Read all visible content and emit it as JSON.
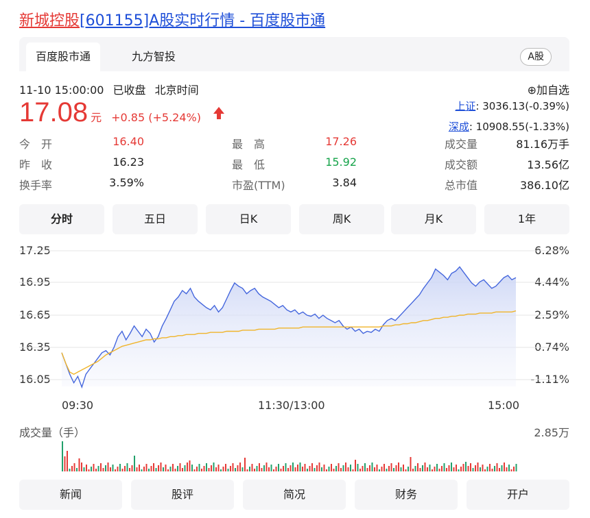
{
  "title": {
    "stock": "新城控股",
    "rest": "[601155]A股实时行情 - 百度股市通"
  },
  "tabs": [
    "百度股市通",
    "九方智投"
  ],
  "market_badge": "A股",
  "status": {
    "datetime": "11-10 15:00:00",
    "state": "已收盘",
    "tz": "北京时间"
  },
  "watchlist": "⊕加自选",
  "quote": {
    "price": "17.08",
    "unit": "元",
    "change": "+0.85 (+5.24%)",
    "up_color": "#e53935",
    "down_color": "#16a34a"
  },
  "indices": [
    {
      "name": "上证",
      "value": ": 3036.13(-0.39%)"
    },
    {
      "name": "深成",
      "value": ": 10908.55(-1.33%)"
    }
  ],
  "stats": [
    [
      {
        "label": "今　开",
        "value": "16.40",
        "color": "red"
      },
      {
        "label": "最　高",
        "value": "17.26",
        "color": "red"
      },
      {
        "label": "成交量",
        "value": "81.16万手",
        "color": "black"
      }
    ],
    [
      {
        "label": "昨　收",
        "value": "16.23",
        "color": "black"
      },
      {
        "label": "最　低",
        "value": "15.92",
        "color": "green"
      },
      {
        "label": "成交额",
        "value": "13.56亿",
        "color": "black"
      }
    ],
    [
      {
        "label": "换手率",
        "value": "3.59%",
        "color": "black"
      },
      {
        "label": "市盈(TTM)",
        "value": "3.84",
        "color": "black"
      },
      {
        "label": "总市值",
        "value": "386.10亿",
        "color": "black"
      }
    ]
  ],
  "periods": [
    "分时",
    "五日",
    "日K",
    "周K",
    "月K",
    "1年"
  ],
  "chart_data": {
    "type": "line",
    "price_ticks": [
      "17.25",
      "16.95",
      "16.65",
      "16.35",
      "16.05"
    ],
    "pct_ticks": [
      "6.28%",
      "4.44%",
      "2.59%",
      "0.74%",
      "-1.11%"
    ],
    "x_ticks": [
      "09:30",
      "11:30/13:00",
      "15:00"
    ],
    "ylim": [
      16.05,
      17.25
    ],
    "price_color": "#4466dd",
    "avg_color": "#f0b429",
    "series": [
      {
        "values": [
          16.3,
          16.2,
          16.1,
          16.02,
          16.08,
          15.98,
          16.1,
          16.15,
          16.2,
          16.25,
          16.3,
          16.32,
          16.28,
          16.35,
          16.45,
          16.5,
          16.42,
          16.48,
          16.55,
          16.5,
          16.45,
          16.52,
          16.48,
          16.4,
          16.45,
          16.55,
          16.62,
          16.7,
          16.78,
          16.82,
          16.88,
          16.85,
          16.9,
          16.82,
          16.78,
          16.75,
          16.72,
          16.7,
          16.74,
          16.68,
          16.72,
          16.8,
          16.88,
          16.95,
          16.92,
          16.9,
          16.85,
          16.88,
          16.9,
          16.85,
          16.82,
          16.8,
          16.78,
          16.75,
          16.72,
          16.74,
          16.7,
          16.68,
          16.7,
          16.66,
          16.68,
          16.65,
          16.64,
          16.66,
          16.62,
          16.65,
          16.62,
          16.6,
          16.58,
          16.6,
          16.55,
          16.52,
          16.54,
          16.5,
          16.52,
          16.48,
          16.5,
          16.49,
          16.52,
          16.5,
          16.56,
          16.6,
          16.62,
          16.6,
          16.64,
          16.68,
          16.72,
          16.76,
          16.8,
          16.84,
          16.9,
          16.95,
          17.0,
          17.08,
          17.05,
          17.02,
          16.98,
          17.04,
          17.06,
          17.1,
          17.05,
          17.0,
          16.95,
          16.92,
          16.96,
          16.98,
          16.94,
          16.9,
          16.92,
          16.96,
          17.0,
          17.02,
          16.98,
          17.0
        ]
      },
      {
        "values": [
          16.3,
          16.2,
          16.12,
          16.1,
          16.12,
          16.14,
          16.16,
          16.18,
          16.2,
          16.22,
          16.25,
          16.28,
          16.3,
          16.32,
          16.34,
          16.36,
          16.37,
          16.38,
          16.39,
          16.4,
          16.41,
          16.42,
          16.42,
          16.43,
          16.43,
          16.44,
          16.44,
          16.45,
          16.45,
          16.46,
          16.46,
          16.47,
          16.47,
          16.47,
          16.48,
          16.48,
          16.48,
          16.49,
          16.49,
          16.49,
          16.49,
          16.5,
          16.5,
          16.5,
          16.5,
          16.51,
          16.51,
          16.51,
          16.51,
          16.52,
          16.52,
          16.52,
          16.52,
          16.52,
          16.53,
          16.53,
          16.53,
          16.53,
          16.53,
          16.53,
          16.54,
          16.54,
          16.54,
          16.54,
          16.54,
          16.54,
          16.54,
          16.54,
          16.54,
          16.54,
          16.54,
          16.54,
          16.54,
          16.54,
          16.54,
          16.54,
          16.54,
          16.54,
          16.54,
          16.54,
          16.55,
          16.55,
          16.55,
          16.56,
          16.56,
          16.57,
          16.57,
          16.58,
          16.58,
          16.59,
          16.6,
          16.6,
          16.61,
          16.62,
          16.62,
          16.63,
          16.63,
          16.64,
          16.64,
          16.65,
          16.65,
          16.66,
          16.66,
          16.66,
          16.67,
          16.67,
          16.67,
          16.67,
          16.68,
          16.68,
          16.68,
          16.68,
          16.68,
          16.69
        ]
      }
    ]
  },
  "volume": {
    "label": "成交量（手）",
    "max": "2.85万"
  },
  "bottom_nav": [
    "新闻",
    "股评",
    "简况",
    "财务",
    "开户"
  ]
}
